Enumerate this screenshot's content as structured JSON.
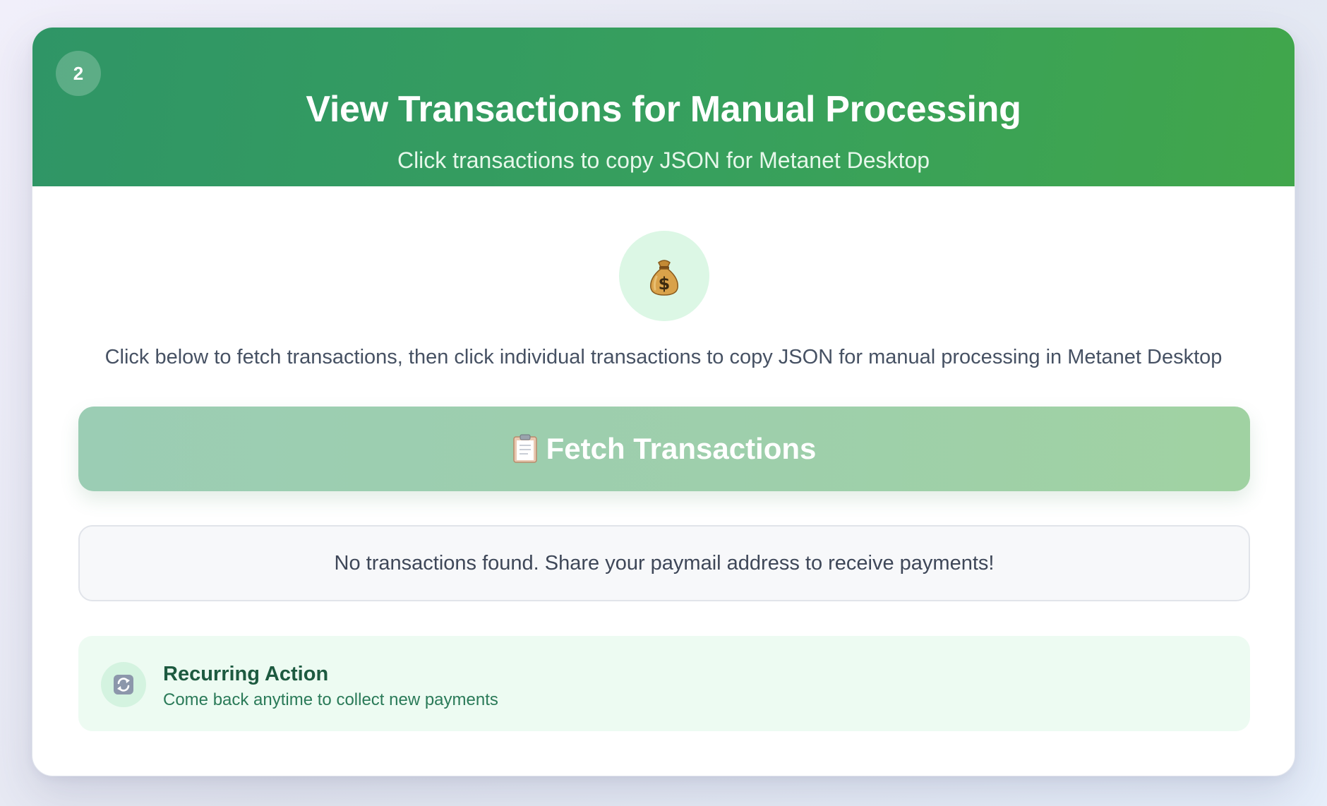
{
  "step": {
    "number": "2"
  },
  "header": {
    "title": "View Transactions for Manual Processing",
    "subtitle": "Click transactions to copy JSON for Metanet Desktop"
  },
  "hero": {
    "icon": "money-bag-icon",
    "description": "Click below to fetch transactions, then click individual transactions to copy JSON for manual processing in Metanet Desktop"
  },
  "fetch_button": {
    "icon": "clipboard-icon",
    "label": "Fetch Transactions"
  },
  "empty_state": {
    "message": "No transactions found. Share your paymail address to receive payments!"
  },
  "recurring": {
    "icon": "refresh-icon",
    "title": "Recurring Action",
    "subtitle": "Come back anytime to collect new payments"
  },
  "colors": {
    "header_start": "#2f9566",
    "header_end": "#41a64b",
    "button": "#9ecfab",
    "recurring_bg": "#edfbf2"
  }
}
